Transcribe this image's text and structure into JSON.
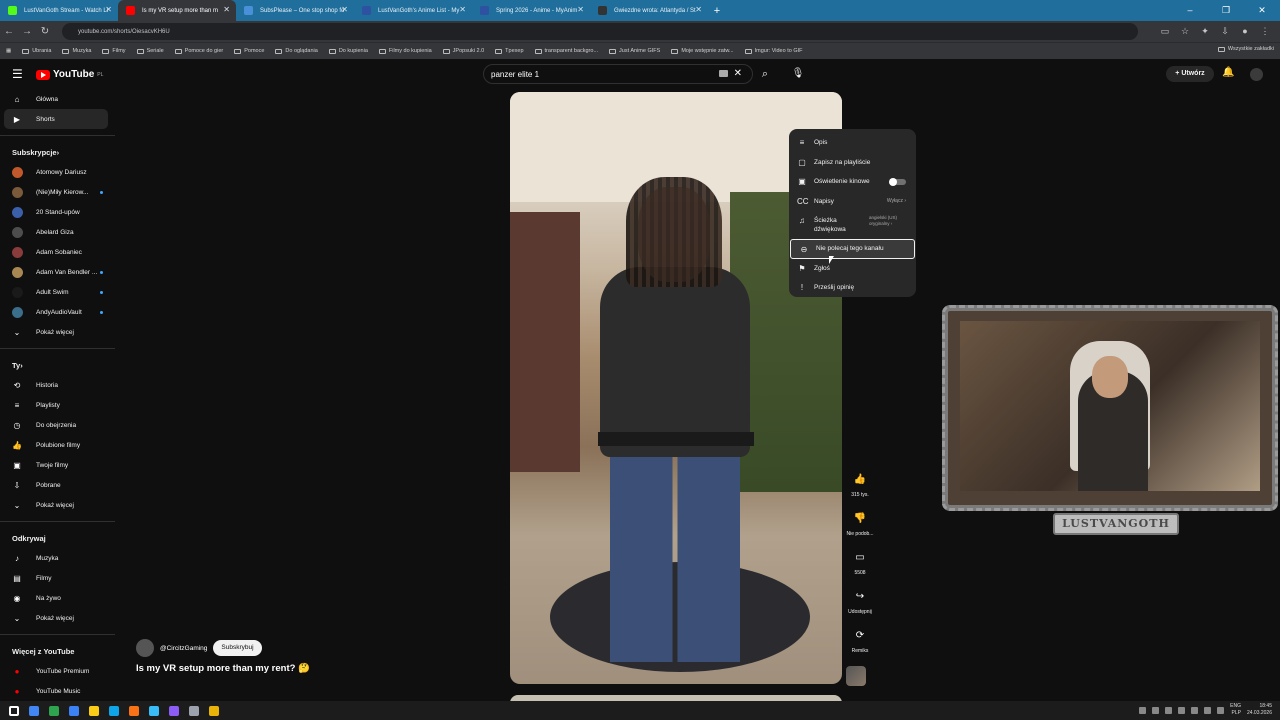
{
  "browser": {
    "tabs": [
      {
        "title": "LustVanGoth Stream - Watch Li",
        "favicon_color": "#53fc18",
        "active": false
      },
      {
        "title": "Is my VR setup more than m",
        "favicon_color": "#ff0000",
        "active": true
      },
      {
        "title": "SubsPlease – One stop shop fo",
        "favicon_color": "#4a90d9",
        "active": false
      },
      {
        "title": "LustVanGoth's Anime List - My",
        "favicon_color": "#2e51a2",
        "active": false
      },
      {
        "title": "Spring 2026 - Anime - MyAnim",
        "favicon_color": "#2e51a2",
        "active": false
      },
      {
        "title": "Gwiezdne wrota: Atlantyda / St",
        "favicon_color": "#333333",
        "active": false
      }
    ],
    "new_tab": "+",
    "window_controls": [
      "–",
      "❐",
      "✕"
    ],
    "url": "youtube.com/shorts/OiesacvKH6U",
    "bookmarks": [
      "Ubrania",
      "Muzyka",
      "Filmy",
      "Seriale",
      "Pomoce do gier",
      "Pomoce",
      "Do oglądania",
      "Do kupienia",
      "Filmy do kupienia",
      "JPopsuki 2.0",
      "Tpexep",
      "transparent backgro...",
      "Just Anime GIFS",
      "Moje wstępnie zatw...",
      "Imgur: Video to GIF"
    ],
    "bookmarks_right": "Wszystkie zakładki"
  },
  "youtube": {
    "logo_text": "YouTube",
    "logo_region": "PL",
    "search_query": "panzer elite 1",
    "create_label": "Utwórz",
    "sidebar": {
      "main": [
        {
          "label": "Główna",
          "icon": "home-icon",
          "active": false
        },
        {
          "label": "Shorts",
          "icon": "shorts-icon",
          "active": true
        }
      ],
      "subscriptions_header": "Subskrypcje",
      "subscriptions": [
        {
          "label": "Atomowy Dariusz",
          "color": "#c0582b",
          "new": false
        },
        {
          "label": "(Nie)Miły Kierow...",
          "color": "#7a5a3a",
          "new": true
        },
        {
          "label": "20 Stand-upów",
          "color": "#3b5fa8",
          "new": false
        },
        {
          "label": "Abelard Giza",
          "color": "#4d4d4d",
          "new": false
        },
        {
          "label": "Adam Sobaniec",
          "color": "#8a3b3b",
          "new": false
        },
        {
          "label": "Adam Van Bendler ...",
          "color": "#a88752",
          "new": true
        },
        {
          "label": "Adult Swim",
          "color": "#1a1a1a",
          "new": true
        },
        {
          "label": "AndyAudioVault",
          "color": "#3b6e8a",
          "new": true
        }
      ],
      "show_more": "Pokaż więcej",
      "you_header": "Ty",
      "you": [
        {
          "label": "Historia",
          "icon": "history-icon"
        },
        {
          "label": "Playlisty",
          "icon": "playlist-icon"
        },
        {
          "label": "Do obejrzenia",
          "icon": "clock-icon"
        },
        {
          "label": "Polubione filmy",
          "icon": "like-icon"
        },
        {
          "label": "Twoje filmy",
          "icon": "video-icon"
        },
        {
          "label": "Pobrane",
          "icon": "download-icon"
        },
        {
          "label": "Pokaż więcej",
          "icon": "chevron-down-icon"
        }
      ],
      "explore_header": "Odkrywaj",
      "explore": [
        {
          "label": "Muzyka",
          "icon": "music-icon"
        },
        {
          "label": "Filmy",
          "icon": "film-icon"
        },
        {
          "label": "Na żywo",
          "icon": "live-icon"
        },
        {
          "label": "Pokaż więcej",
          "icon": "chevron-down-icon"
        }
      ],
      "more_header": "Więcej z YouTube",
      "more": [
        {
          "label": "YouTube Premium",
          "icon": "yt-premium-icon"
        },
        {
          "label": "YouTube Music",
          "icon": "yt-music-icon"
        }
      ]
    },
    "short": {
      "channel": "@CircitzGaming",
      "subscribe": "Subskrybuj",
      "title": "Is my VR setup more than my rent? 🤔",
      "actions": [
        {
          "icon": "like-icon",
          "label": "315 tys."
        },
        {
          "icon": "dislike-icon",
          "label": "Nie podob..."
        },
        {
          "icon": "comment-icon",
          "label": "5508"
        },
        {
          "icon": "share-icon",
          "label": "Udostępnij"
        },
        {
          "icon": "remix-icon",
          "label": "Remiks"
        }
      ]
    },
    "menu": [
      {
        "label": "Opis",
        "icon": "description-icon"
      },
      {
        "label": "Zapisz na playliście",
        "icon": "bookmark-icon"
      },
      {
        "label": "Oświetlenie kinowe",
        "icon": "ambient-icon",
        "toggle": true
      },
      {
        "label": "Napisy",
        "icon": "captions-icon",
        "right": "Wyłącz ›"
      },
      {
        "label": "Ścieżka dźwiękowa",
        "icon": "audio-track-icon",
        "right": "angielski (US) oryginalny ›"
      },
      {
        "label": "Nie polecaj tego kanału",
        "icon": "block-icon",
        "highlighted": true
      },
      {
        "label": "Zgłoś",
        "icon": "flag-icon"
      },
      {
        "label": "Prześlij opinię",
        "icon": "feedback-icon"
      }
    ]
  },
  "stream_overlay": {
    "name": "LUSTVANGOTH"
  },
  "taskbar": {
    "lang_line1": "ENG",
    "lang_line2": "PLP",
    "time": "18:45",
    "date": "24.03.2026",
    "app_colors": [
      "#ffffff",
      "#4285f4",
      "#2ea44f",
      "#3b82f6",
      "#facc15",
      "#0ea5e9",
      "#f97316",
      "#38bdf8",
      "#8b5cf6",
      "#9ca3af",
      "#eab308"
    ]
  }
}
